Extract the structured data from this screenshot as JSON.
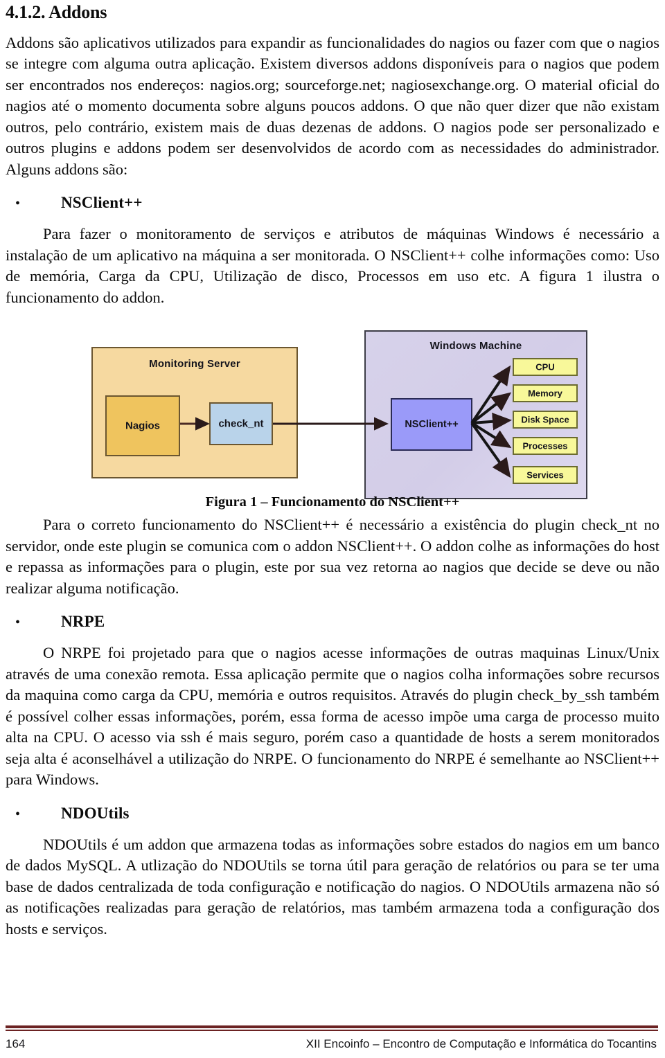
{
  "document": {
    "heading": "4.1.2. Addons",
    "paragraphs": {
      "intro": "Addons são aplicativos utilizados para expandir as funcionalidades do nagios ou fazer com que o nagios se integre com alguma outra aplicação. Existem diversos addons disponíveis para o nagios que podem ser encontrados nos endereços: nagios.org; sourceforge.net; nagiosexchange.org. O material oficial do nagios até o momento documenta sobre alguns poucos addons. O que não quer dizer que não existam outros, pelo contrário, existem mais de duas dezenas de addons. O nagios pode ser personalizado e outros plugins e addons podem ser desenvolvidos de acordo com as necessidades do administrador. Alguns addons são:",
      "nsclient_intro": "Para fazer o monitoramento de serviços e atributos de máquinas Windows é necessário a instalação de um aplicativo na máquina a ser monitorada. O NSClient++ colhe informações como: Uso de memória, Carga da CPU, Utilização de disco, Processos em uso etc. A figura 1 ilustra o funcionamento do addon.",
      "nsclient_after_figure": "Para o correto funcionamento do NSClient++ é necessário a existência do plugin check_nt no servidor, onde este plugin se comunica com o addon NSClient++. O addon colhe as informações do host e repassa as informações para o plugin, este por sua vez retorna ao nagios que decide se deve ou não realizar alguma notificação.",
      "nrpe": "O NRPE foi projetado para que o nagios acesse informações de outras maquinas Linux/Unix através de uma conexão remota. Essa aplicação permite que o nagios colha informações sobre recursos da maquina como carga da CPU, memória e outros requisitos. Através do plugin check_by_ssh também é possível colher essas informações, porém, essa forma de acesso impõe uma carga de processo muito alta na CPU. O acesso via ssh é mais seguro, porém caso a quantidade de hosts a serem monitorados seja alta é aconselhável a utilização do NRPE. O funcionamento do NRPE é semelhante ao NSClient++ para Windows.",
      "ndoutils": "NDOUtils é um addon que armazena todas as informações sobre estados do nagios em um banco de dados MySQL. A utlização do NDOUtils se torna útil para geração de relatórios ou para se ter uma base de dados centralizada de toda configuração e notificação do nagios. O NDOUtils armazena não só as notificações realizadas para geração de relatórios, mas também armazena toda a configuração dos hosts e serviços."
    },
    "bullets": {
      "nsclient": "NSClient++",
      "nrpe": "NRPE",
      "ndoutils": "NDOUtils"
    }
  },
  "figure": {
    "caption": "Figura 1 – Funcionamento do NSClient++",
    "monitoring_server": {
      "title": "Monitoring Server",
      "nagios": "Nagios",
      "check_nt": "check_nt"
    },
    "windows_machine": {
      "title": "Windows Machine",
      "nsclient": "NSClient++",
      "resources": [
        "CPU",
        "Memory",
        "Disk Space",
        "Processes",
        "Services"
      ]
    },
    "colors": {
      "monitoring_server_bg": "#f6d9a0",
      "nagios_bg": "#efc45e",
      "check_nt_bg": "#b9d3ea",
      "windows_machine_bg": "#d5d0e8",
      "nsclient_bg": "#9a9af9",
      "resource_bg": "#f8f89a",
      "arrow": "#2a1a1a"
    }
  },
  "footer": {
    "page_number": "164",
    "conference": "XII Encoinfo – Encontro de Computação e Informática do Tocantins",
    "rule_color": "#6b2222"
  }
}
